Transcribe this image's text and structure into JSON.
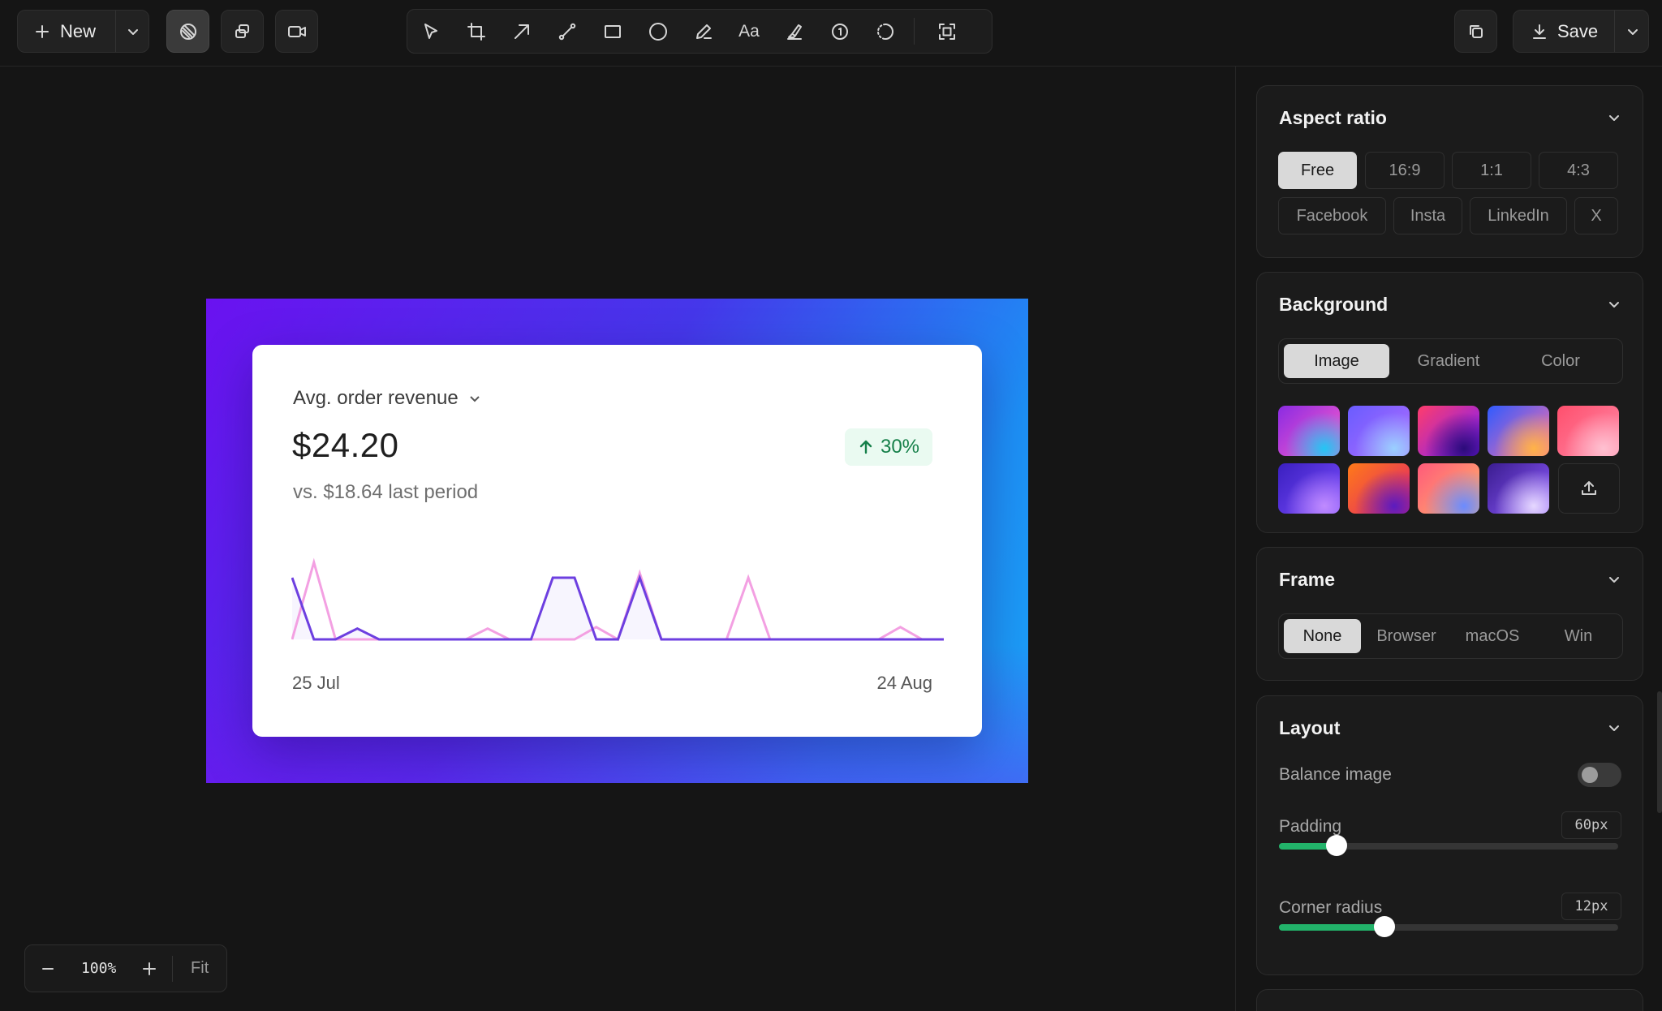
{
  "topbar": {
    "new_label": "New",
    "save_label": "Save",
    "mode_buttons": [
      "screenshot-mode-icon",
      "multi-window-mode-icon",
      "video-mode-icon"
    ],
    "tools": [
      "select",
      "crop",
      "arrow",
      "line",
      "rectangle",
      "ellipse",
      "pen",
      "text",
      "highlighter",
      "counter",
      "blur",
      "fit-frame"
    ],
    "text_tool_label": "Aa"
  },
  "card": {
    "metric_label": "Avg. order revenue",
    "value": "$24.20",
    "compare": "vs. $18.64 last period",
    "change": "30%",
    "date_start": "25 Jul",
    "date_end": "24 Aug"
  },
  "chart_data": {
    "type": "line",
    "x_start": "25 Jul",
    "x_end": "24 Aug",
    "series": [
      {
        "color": "#6d3fe0",
        "values": [
          4,
          0,
          0,
          0.7,
          0,
          0,
          0,
          0,
          0,
          0,
          0,
          0,
          4,
          4,
          0,
          0,
          4,
          0,
          0,
          0,
          0,
          0,
          0,
          0,
          0,
          0,
          0,
          0,
          0,
          0,
          0
        ]
      },
      {
        "color": "#f3a0e2",
        "values": [
          0,
          5,
          0,
          0,
          0,
          0,
          0,
          0,
          0,
          0.7,
          0,
          0,
          0,
          0,
          0.8,
          0,
          4.3,
          0,
          0,
          0,
          0,
          4,
          0,
          0,
          0,
          0,
          0,
          0,
          0.8,
          0,
          0
        ]
      }
    ]
  },
  "zoom": {
    "level": "100%",
    "fit_label": "Fit"
  },
  "sidebar": {
    "aspect": {
      "title": "Aspect ratio",
      "options": [
        "Free",
        "16:9",
        "1:1",
        "4:3",
        "Facebook",
        "Insta",
        "LinkedIn",
        "X"
      ],
      "selected": "Free"
    },
    "background": {
      "title": "Background",
      "tabs": [
        "Image",
        "Gradient",
        "Color"
      ],
      "selected": "Image",
      "thumbnails": [
        [
          "#8a2be2",
          "#ff5ecb",
          "#23c6f4"
        ],
        [
          "#6a5cff",
          "#b06dff",
          "#9ad0ff"
        ],
        [
          "#ff3d6b",
          "#7a1cff",
          "#2b0b7a"
        ],
        [
          "#2f5bff",
          "#ff6fa8",
          "#ffb347"
        ],
        [
          "#ff4f6d",
          "#ff8aa8",
          "#ffc1d1"
        ],
        [
          "#3a1fbf",
          "#7b4dff",
          "#c08bff"
        ],
        [
          "#ff7a18",
          "#e0216d",
          "#5b1bbf"
        ],
        [
          "#ff5a7a",
          "#ffb46b",
          "#6b8bff"
        ],
        [
          "#3a1c8f",
          "#8e5bff",
          "#e6d8ff"
        ]
      ]
    },
    "frame": {
      "title": "Frame",
      "options": [
        "None",
        "Browser",
        "macOS",
        "Win"
      ],
      "selected": "None"
    },
    "layout": {
      "title": "Layout",
      "balance_label": "Balance image",
      "balance_on": false,
      "padding_label": "Padding",
      "padding_value": "60px",
      "padding_fraction": 0.17,
      "radius_label": "Corner radius",
      "radius_value": "12px",
      "radius_fraction": 0.31
    }
  },
  "colors": {
    "accent": "#22b36a",
    "app_bg": "#151515",
    "panel_bg": "#1b1b1b"
  }
}
